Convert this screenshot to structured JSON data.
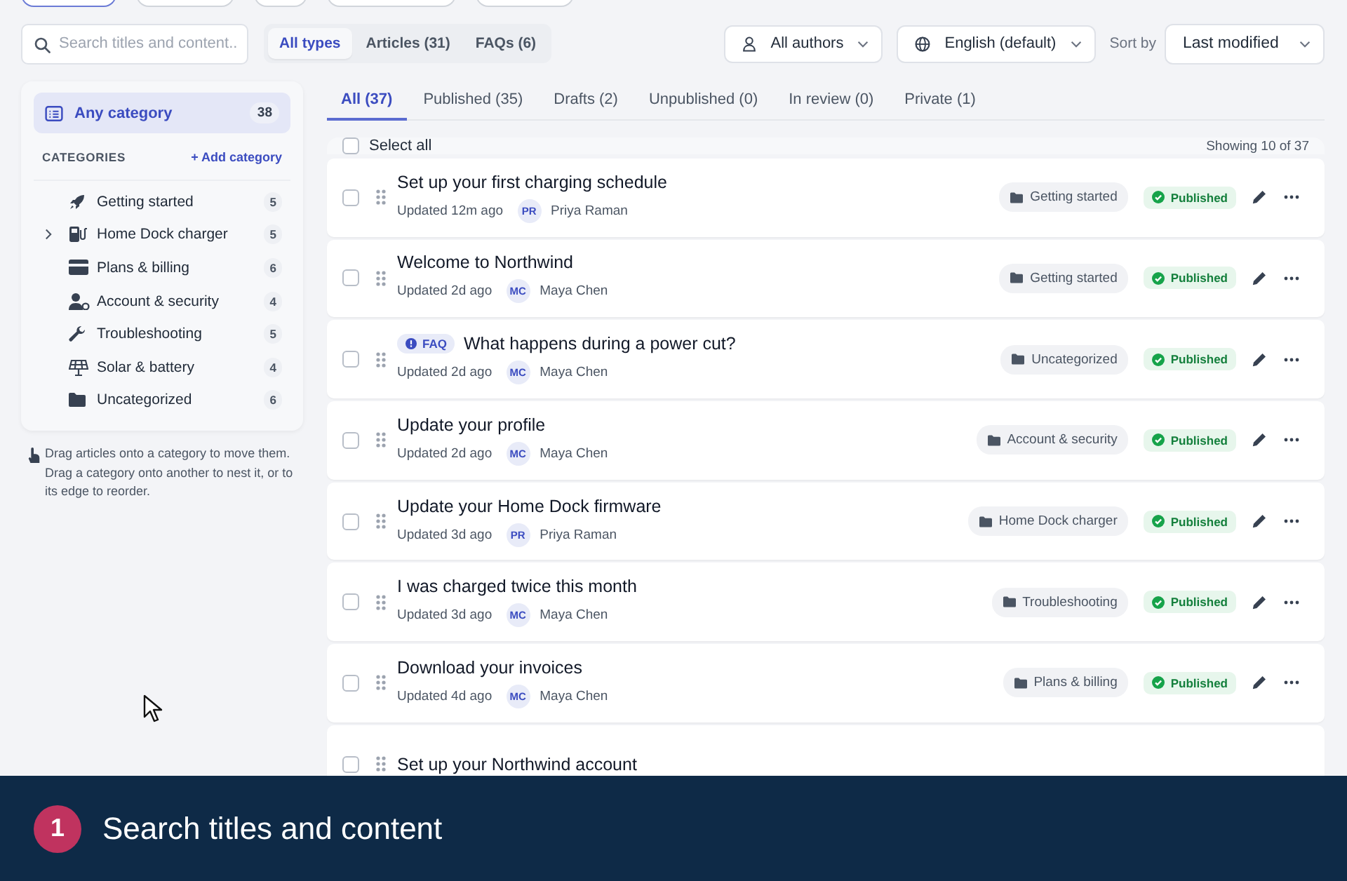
{
  "top_nav": {
    "pills": [
      {
        "selected": true
      },
      {
        "selected": false
      },
      {
        "selected": false
      },
      {
        "selected": false
      },
      {
        "selected": false
      }
    ]
  },
  "toolbar": {
    "search": {
      "placeholder": "Search titles and content..."
    },
    "type_filters": [
      {
        "label": "All types",
        "selected": true
      },
      {
        "label": "Articles (31)",
        "selected": false
      },
      {
        "label": "FAQs (6)",
        "selected": false
      }
    ],
    "author_filter": "All authors",
    "language_filter": "English (default)",
    "sort_label": "Sort by",
    "sort_value": "Last modified"
  },
  "sidebar": {
    "any_category": {
      "label": "Any category",
      "count": "38",
      "selected": true
    },
    "heading": "CATEGORIES",
    "add_label": "+ Add category",
    "categories": [
      {
        "label": "Getting started",
        "count": "5",
        "collapsible": false,
        "selected": false
      },
      {
        "label": "Home Dock charger",
        "count": "5",
        "collapsible": true,
        "selected": false
      },
      {
        "label": "Plans & billing",
        "count": "6",
        "collapsible": false,
        "selected": false
      },
      {
        "label": "Account & security",
        "count": "4",
        "collapsible": false,
        "selected": false
      },
      {
        "label": "Troubleshooting",
        "count": "5",
        "collapsible": false,
        "selected": false
      },
      {
        "label": "Solar & battery",
        "count": "4",
        "collapsible": false,
        "selected": false
      },
      {
        "label": "Uncategorized",
        "count": "6",
        "collapsible": false,
        "selected": false
      }
    ],
    "hint": "Drag articles onto a category to move them. Drag a category onto another to nest it, or to its edge to reorder."
  },
  "status_tabs": [
    {
      "label": "All (37)",
      "selected": true
    },
    {
      "label": "Published (35)",
      "selected": false
    },
    {
      "label": "Drafts (2)",
      "selected": false
    },
    {
      "label": "Unpublished (0)",
      "selected": false
    },
    {
      "label": "In review (0)",
      "selected": false
    },
    {
      "label": "Private (1)",
      "selected": false
    }
  ],
  "list": {
    "select_all": {
      "label": "Select all",
      "checked": false
    },
    "showing": "Showing 10 of 37",
    "rows": [
      {
        "kind": "article",
        "title": "Set up your first charging schedule",
        "updated": "Updated 12m ago",
        "initials": "PR",
        "author": "Priya Raman",
        "category": "Getting started",
        "status": "Published",
        "checked": false
      },
      {
        "kind": "article",
        "title": "Welcome to Northwind",
        "updated": "Updated 2d ago",
        "initials": "MC",
        "author": "Maya Chen",
        "category": "Getting started",
        "status": "Published",
        "checked": false
      },
      {
        "kind": "faq",
        "badge": "FAQ",
        "title": "What happens during a power cut?",
        "updated": "Updated 2d ago",
        "initials": "MC",
        "author": "Maya Chen",
        "category": "Uncategorized",
        "status": "Published",
        "checked": false
      },
      {
        "kind": "article",
        "title": "Update your profile",
        "updated": "Updated 2d ago",
        "initials": "MC",
        "author": "Maya Chen",
        "category": "Account & security",
        "status": "Published",
        "checked": false
      },
      {
        "kind": "article",
        "title": "Update your Home Dock firmware",
        "updated": "Updated 3d ago",
        "initials": "PR",
        "author": "Priya Raman",
        "category": "Home Dock charger",
        "status": "Published",
        "checked": false
      },
      {
        "kind": "article",
        "title": "I was charged twice this month",
        "updated": "Updated 3d ago",
        "initials": "MC",
        "author": "Maya Chen",
        "category": "Troubleshooting",
        "status": "Published",
        "checked": false
      },
      {
        "kind": "article",
        "title": "Download your invoices",
        "updated": "Updated 4d ago",
        "initials": "MC",
        "author": "Maya Chen",
        "category": "Plans & billing",
        "status": "Published",
        "checked": false
      },
      {
        "kind": "article",
        "title": "Set up your Northwind account"
      }
    ]
  },
  "caption": {
    "step": "1",
    "text": "Search titles and content"
  }
}
